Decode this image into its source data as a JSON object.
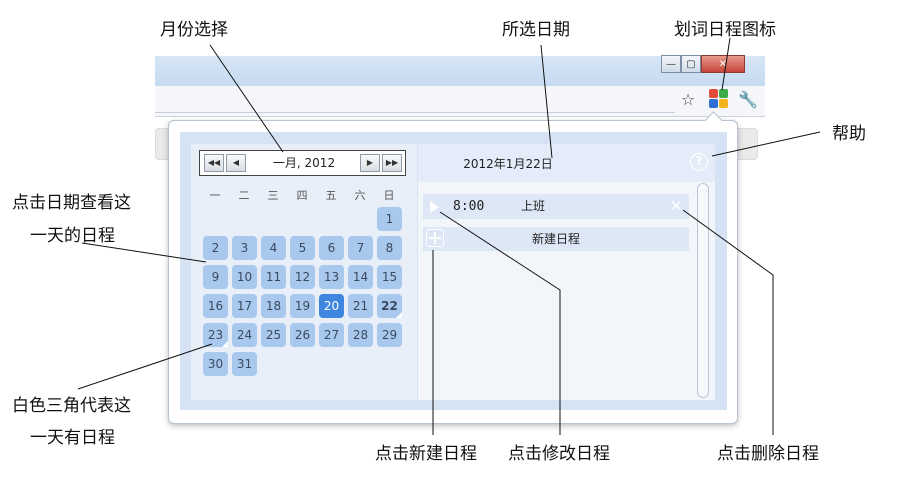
{
  "annotations": {
    "month_select": "月份选择",
    "selected_date": "所选日期",
    "ext_icon": "划词日程图标",
    "help": "帮助",
    "click_date_line1": "点击日期查看这",
    "click_date_line2": "一天的日程",
    "white_triangle_line1": "白色三角代表这",
    "white_triangle_line2": "一天有日程",
    "click_new": "点击新建日程",
    "click_edit": "点击修改日程",
    "click_delete": "点击删除日程"
  },
  "window_controls": {
    "minimize": "—",
    "maximize": "▢",
    "close": "✕"
  },
  "toolbar": {
    "star": "☆",
    "wrench": "🔧"
  },
  "calendar": {
    "month_label": "一月, 2012",
    "prev_year": "◀◀",
    "prev_month": "◀",
    "next_month": "▶",
    "next_year": "▶▶",
    "weekdays": [
      "一",
      "二",
      "三",
      "四",
      "五",
      "六",
      "日"
    ],
    "days": [
      "1",
      "2",
      "3",
      "4",
      "5",
      "6",
      "7",
      "8",
      "9",
      "10",
      "11",
      "12",
      "13",
      "14",
      "15",
      "16",
      "17",
      "18",
      "19",
      "20",
      "21",
      "22",
      "23",
      "24",
      "25",
      "26",
      "27",
      "28",
      "29",
      "30",
      "31"
    ],
    "selected_day": "20",
    "bold_day": "22",
    "marked_days": [
      "22",
      "23"
    ]
  },
  "schedule": {
    "date_title": "2012年1月22日",
    "help_icon": "?",
    "event": {
      "time": "8:00",
      "title": "上班",
      "delete": "✕"
    },
    "new_label": "新建日程"
  },
  "colors": {
    "day_bg": "#a9c8ee",
    "day_selected": "#3f86e0",
    "panel_bg": "#d5e3f4"
  }
}
